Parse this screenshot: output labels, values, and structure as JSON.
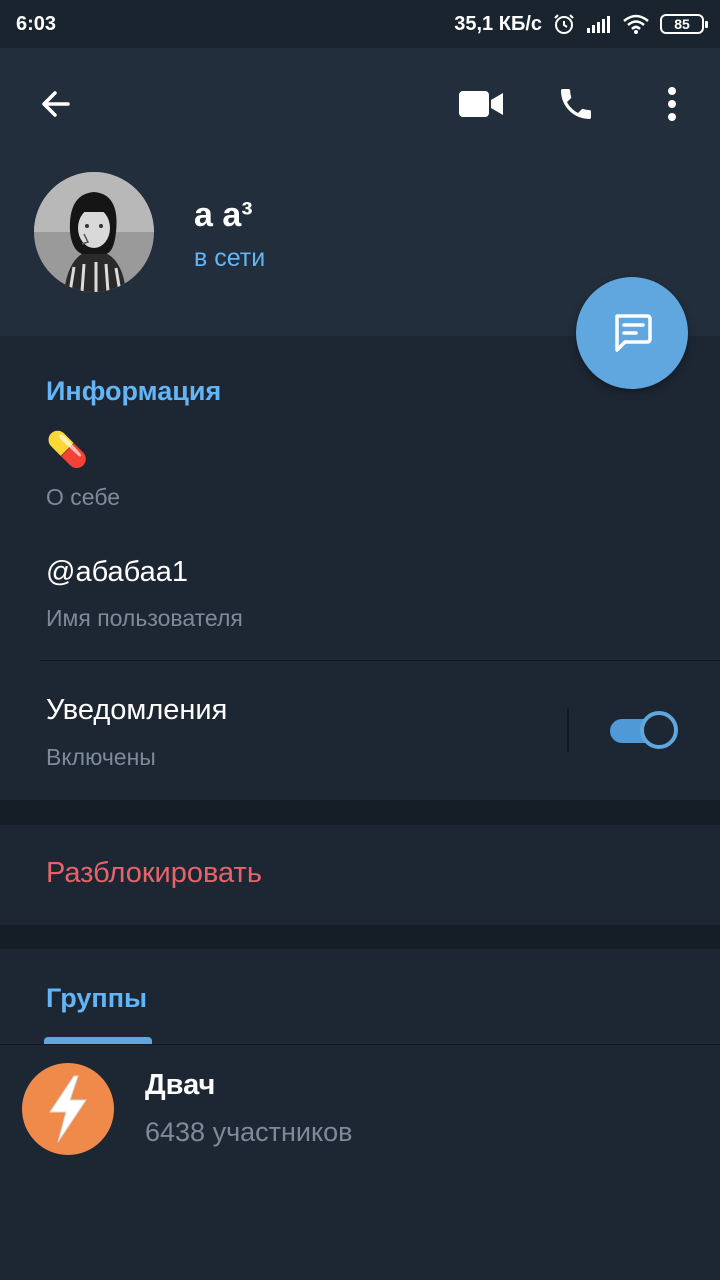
{
  "status_bar": {
    "time": "6:03",
    "network_speed": "35,1 КБ/с",
    "battery": "85"
  },
  "header": {
    "icons": {
      "back": "arrow-left-icon",
      "video": "video-camera-icon",
      "call": "phone-icon",
      "more": "more-vertical-icon"
    },
    "name": "а а³",
    "status": "в сети",
    "fab_icon": "message-icon"
  },
  "info": {
    "title": "Информация",
    "bio": "💊",
    "bio_label": "О себе",
    "username": "@абабаа1",
    "username_label": "Имя пользователя",
    "notifications": "Уведомления",
    "notifications_state": "Включены",
    "notifications_on": true
  },
  "unblock": {
    "label": "Разблокировать"
  },
  "groups": {
    "tab_label": "Группы",
    "items": [
      {
        "name": "Двач",
        "members": "6438 участников"
      }
    ]
  },
  "colors": {
    "accent": "#64b5f6",
    "danger": "#e5646b",
    "background": "#1d2733",
    "header": "#222e3b"
  }
}
